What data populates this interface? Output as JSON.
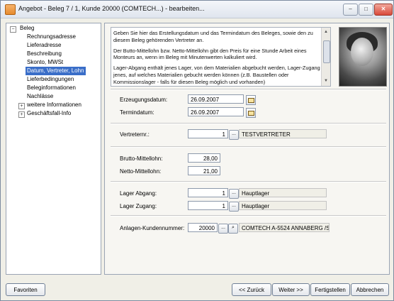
{
  "window": {
    "title": "Angebot - Beleg 7 / 1, Kunde 20000 (COMTECH...) - bearbeiten...",
    "minimize": "–",
    "maximize": "□",
    "close": "✕"
  },
  "nav": {
    "root": "Beleg",
    "items": [
      "Rechnungsadresse",
      "Lieferadresse",
      "Beschreibung",
      "Skonto, MWSt",
      "Datum, Vertreter, Lohn",
      "Lieferbedingungen",
      "Beleginformationen",
      "Nachlässe"
    ],
    "weitere": "weitere Informationen",
    "geschaeftsfall": "Geschäftsfall-Info",
    "selected_index": 4
  },
  "info": {
    "p1": "Geben Sie hier das Erstellungsdatum und das Termindatum des Beleges, sowie den zu diesem Beleg gehörenden Vertreter an.",
    "p2": "Der Butto-Mittellohn bzw. Netto-Mittellohn gibt den Preis für eine Stunde Arbeit eines Monteurs an, wenn im Beleg mit Minutenwerten kalkuliert wird.",
    "p3": "Lager-Abgang enthält jenes Lager, von dem Materialien abgebucht werden, Lager-Zugang jenes, auf welches Materialien gebucht werden können (z.B. Baustellen oder Kommissionslager - falls für diesen Beleg möglich und vorhanden)"
  },
  "form": {
    "erzeugungsdatum_label": "Erzeugungsdatum:",
    "erzeugungsdatum": "26.09.2007",
    "termindatum_label": "Termindatum:",
    "termindatum": "26.09.2007",
    "vertreter_label": "Vertreternr.:",
    "vertreter_nr": "1",
    "vertreter_name": "TESTVERTRETER",
    "brutto_label": "Brutto-Mittellohn:",
    "brutto": "28,00",
    "netto_label": "Netto-Mittellohn:",
    "netto": "21,00",
    "lager_abgang_label": "Lager Abgang:",
    "lager_abgang_nr": "1",
    "lager_abgang_name": "Hauptlager",
    "lager_zugang_label": "Lager Zugang:",
    "lager_zugang_nr": "1",
    "lager_zugang_name": "Hauptlager",
    "anlagen_label": "Anlagen-Kundennummer:",
    "anlagen_nr": "20000",
    "anlagen_name": "COMTECH A-5524 ANNABERG /S",
    "ellipsis": "..."
  },
  "buttons": {
    "favoriten": "Favoriten",
    "zurueck": "<< Zurück",
    "weiter": "Weiter >>",
    "fertigstellen": "Fertigstellen",
    "abbrechen": "Abbrechen"
  }
}
